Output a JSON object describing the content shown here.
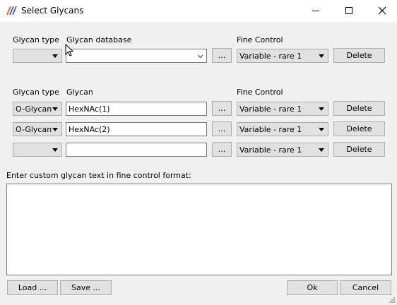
{
  "window": {
    "title": "Select Glycans"
  },
  "database_section": {
    "glycan_type_label": "Glycan type",
    "database_label": "Glycan database",
    "fine_control_label": "Fine Control",
    "glycan_type_value": "",
    "database_value": "",
    "browse_label": "...",
    "fine_control_value": "Variable - rare 1",
    "delete_label": "Delete"
  },
  "glycan_section": {
    "glycan_type_label": "Glycan type",
    "glycan_label": "Glycan",
    "fine_control_label": "Fine Control",
    "rows": [
      {
        "type": "O-Glycan",
        "glycan": "HexNAc(1)",
        "browse": "...",
        "fine_control": "Variable - rare 1",
        "delete": "Delete"
      },
      {
        "type": "O-Glycan",
        "glycan": "HexNAc(2)",
        "browse": "...",
        "fine_control": "Variable - rare 1",
        "delete": "Delete"
      },
      {
        "type": "",
        "glycan": "",
        "browse": "...",
        "fine_control": "Variable - rare 1",
        "delete": "Delete"
      }
    ]
  },
  "custom": {
    "label": "Enter custom glycan text in fine control format:",
    "value": ""
  },
  "footer": {
    "load_label": "Load ...",
    "save_label": "Save ...",
    "ok_label": "Ok",
    "cancel_label": "Cancel"
  }
}
